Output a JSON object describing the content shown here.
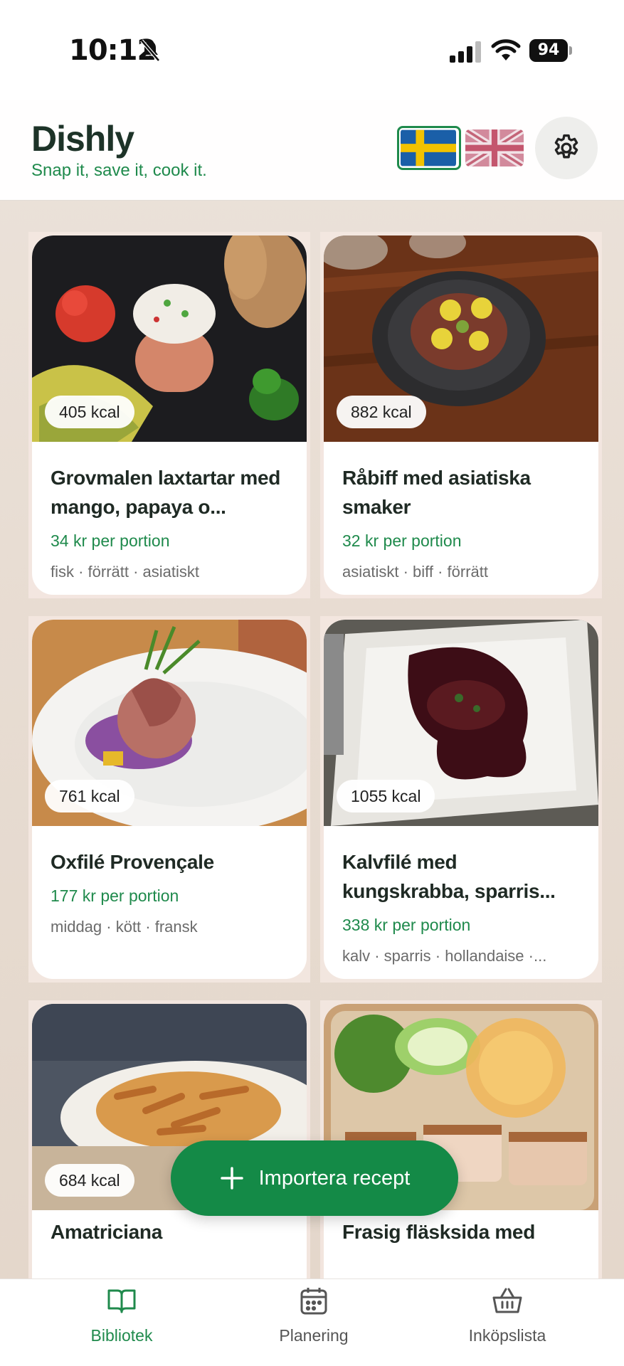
{
  "status_bar": {
    "time": "10:12",
    "battery": "94"
  },
  "header": {
    "title": "Dishly",
    "tagline": "Snap it, save it, cook it.",
    "languages": [
      "Svenska",
      "English"
    ],
    "active_language": "Svenska"
  },
  "recipes": [
    {
      "kcal": "405 kcal",
      "title": "Grovmalen laxtartar med mango, papaya o...",
      "price": "34 kr per portion",
      "tags": "fisk · förrätt · asiatiskt"
    },
    {
      "kcal": "882 kcal",
      "title": "Råbiff med asiatiska smaker",
      "price": "32 kr per portion",
      "tags": "asiatiskt · biff · förrätt"
    },
    {
      "kcal": "761 kcal",
      "title": "Oxfilé Provençale",
      "price": "177 kr per portion",
      "tags": "middag · kött · fransk"
    },
    {
      "kcal": "1055 kcal",
      "title": "Kalvfilé med kungskrabba, sparris...",
      "price": "338 kr per portion",
      "tags": "kalv · sparris · hollandaise ·..."
    },
    {
      "kcal": "684 kcal",
      "title": "Amatriciana",
      "price": "",
      "tags": ""
    },
    {
      "kcal": "",
      "title": "Frasig fläsksida med",
      "price": "",
      "tags": ""
    }
  ],
  "fab": {
    "label": "Importera recept"
  },
  "nav": {
    "items": [
      {
        "label": "Bibliotek",
        "icon": "book-icon"
      },
      {
        "label": "Planering",
        "icon": "calendar-icon"
      },
      {
        "label": "Inköpslista",
        "icon": "basket-icon"
      }
    ],
    "active": "Bibliotek"
  },
  "colors": {
    "accent": "#1f8a4c",
    "fab": "#148a47",
    "title": "#1d3328"
  }
}
